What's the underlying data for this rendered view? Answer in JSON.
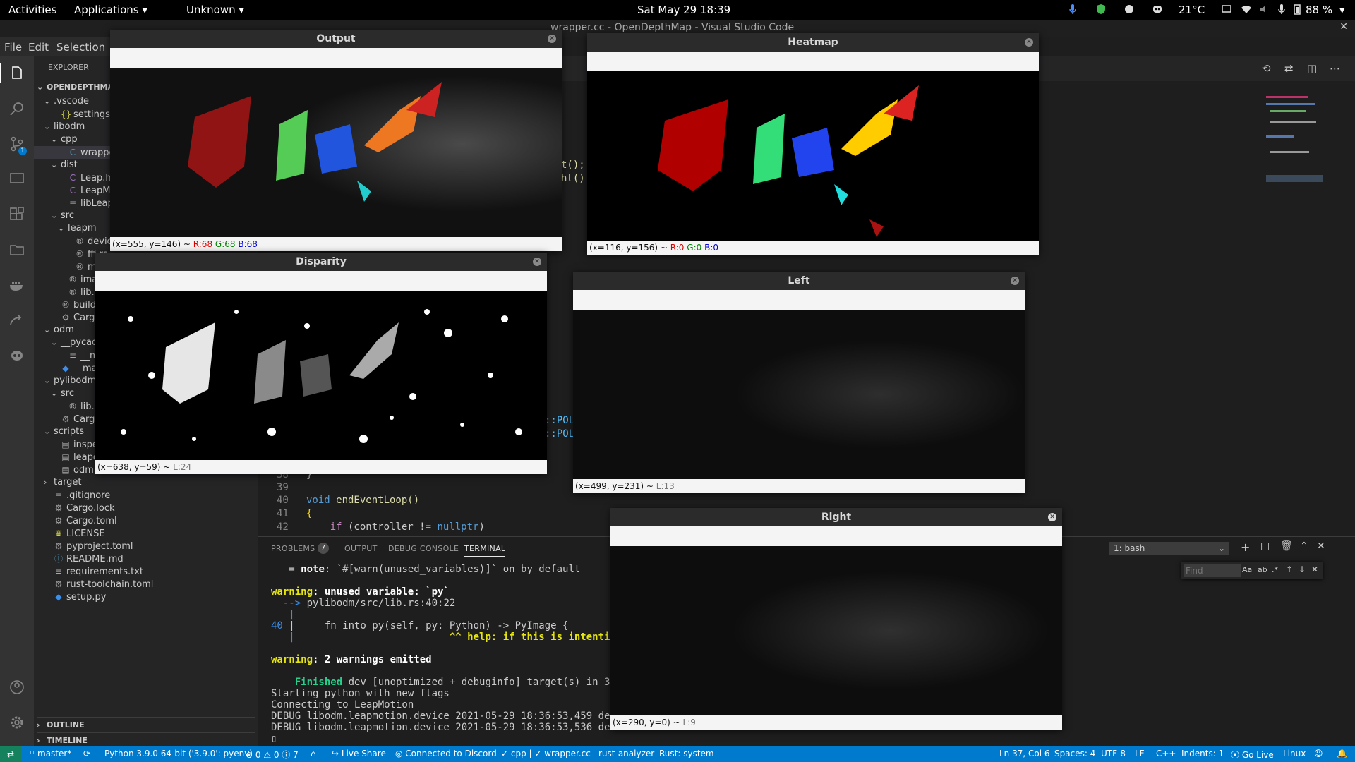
{
  "topbar": {
    "activities": "Activities",
    "applications": "Applications ▾",
    "unknown": "Unknown ▾",
    "clock": "Sat May 29  18:39",
    "temperature": "21°C",
    "battery": "88 %"
  },
  "vscode": {
    "window_title": "wrapper.cc - OpenDepthMap - Visual Studio Code",
    "menu": {
      "file": "File",
      "edit": "Edit",
      "selection": "Selection"
    },
    "explorer": {
      "header": "EXPLORER",
      "root": "OPENDEPTHMAI",
      "items": [
        {
          "label": ".vscode",
          "kind": "folder"
        },
        {
          "label": "settings.json",
          "kind": "json"
        },
        {
          "label": "libodm",
          "kind": "folder"
        },
        {
          "label": "cpp",
          "kind": "folder"
        },
        {
          "label": "wrapper.cc",
          "kind": "cpp"
        },
        {
          "label": "dist",
          "kind": "folder"
        },
        {
          "label": "Leap.h",
          "kind": "c"
        },
        {
          "label": "LeapMath",
          "kind": "c"
        },
        {
          "label": "libLeap.so",
          "kind": "file"
        },
        {
          "label": "src",
          "kind": "folder"
        },
        {
          "label": "leapm",
          "kind": "folder"
        },
        {
          "label": "devic",
          "kind": "rs"
        },
        {
          "label": "ffi.rs",
          "kind": "rs"
        },
        {
          "label": "mod.",
          "kind": "rs"
        },
        {
          "label": "image",
          "kind": "rs"
        },
        {
          "label": "lib.rs",
          "kind": "rs"
        },
        {
          "label": "build.rs",
          "kind": "rs"
        },
        {
          "label": "Cargo.t",
          "kind": "gear"
        },
        {
          "label": "odm",
          "kind": "folder"
        },
        {
          "label": "__pycac",
          "kind": "folder"
        },
        {
          "label": "__mai",
          "kind": "file"
        },
        {
          "label": "__main_",
          "kind": "py"
        },
        {
          "label": "pylibodm",
          "kind": "folder"
        },
        {
          "label": "src",
          "kind": "folder"
        },
        {
          "label": "lib.rs",
          "kind": "rs"
        },
        {
          "label": "Cargo.toml",
          "kind": "gear"
        },
        {
          "label": "scripts",
          "kind": "folder"
        },
        {
          "label": "inspect-core.sh",
          "kind": "sh"
        },
        {
          "label": "leapdebug.sh",
          "kind": "sh"
        },
        {
          "label": "odm.sh",
          "kind": "sh"
        },
        {
          "label": "target",
          "kind": "folder-closed"
        },
        {
          "label": ".gitignore",
          "kind": "file"
        },
        {
          "label": "Cargo.lock",
          "kind": "gear"
        },
        {
          "label": "Cargo.toml",
          "kind": "gear"
        },
        {
          "label": "LICENSE",
          "kind": "license"
        },
        {
          "label": "pyproject.toml",
          "kind": "gear"
        },
        {
          "label": "README.md",
          "kind": "info"
        },
        {
          "label": "requirements.txt",
          "kind": "file"
        },
        {
          "label": "rust-toolchain.toml",
          "kind": "gear"
        },
        {
          "label": "setup.py",
          "kind": "py"
        }
      ],
      "outline": "OUTLINE",
      "timeline": "TIMELINE"
    },
    "code": {
      "frag1": "t();",
      "frag2": "ht()",
      "frag3": "::POL",
      "frag4": "::POL",
      "l38": "38",
      "l39": "39",
      "l40": "40",
      "l41": "41",
      "l42": "42",
      "c38": "}",
      "c40_kw": "void",
      "c40_fn": " endEventLoop()",
      "c41": "{",
      "c42_kw": "    if",
      "c42_rest": " (controller != ",
      "c42_null": "nullptr",
      "c42_end": ")"
    },
    "panel": {
      "problems": "PROBLEMS",
      "problems_count": "7",
      "output": "OUTPUT",
      "debug_console": "DEBUG CONSOLE",
      "terminal": "TERMINAL",
      "shell": "1: bash",
      "find_placeholder": "Find",
      "lines": {
        "t1a": "   = ",
        "t1b": "note",
        "t1c": ": `#[warn(unused_variables)]` on by default",
        "t2a": "warning",
        "t2b": ": unused variable: `py`",
        "t3a": "  --> ",
        "t3b": "pylibodm/src/lib.rs:40:22",
        "t4": "   |",
        "t5a": "40",
        "t5b": " |     fn into_py(self, py: Python) -> PyImage {",
        "t6a": "   |",
        "t6b": "                          ^^ help: if this is intentional, p",
        "t7a": "warning",
        "t7b": ": 2 warnings emitted",
        "t8a": "    Finished",
        "t8b": " dev [unoptimized + debuginfo] target(s) in 3.22",
        "t9": "Starting python with new flags",
        "t10": "Connecting to LeapMotion",
        "t11": "DEBUG libodm.leapmotion.device 2021-05-29 18:36:53,459 devic",
        "t12": "DEBUG libodm.leapmotion.device 2021-05-29 18:36:53,536 devic",
        "t13": "▯"
      }
    },
    "status": {
      "remote": "⇄",
      "branch": "master*",
      "sync": "⟳",
      "python": "Python 3.9.0 64-bit ('3.9.0': pyenv)",
      "problems": "⊗ 0 ⚠ 0 ⓘ 7",
      "home": "⌂",
      "liveshare": "Live Share",
      "discord": "Connected to Discord",
      "cpp": "✓ cpp | ✓ wrapper.cc",
      "rust": "rust-analyzer",
      "rustsys": "Rust: system",
      "pos": "Ln 37, Col 6",
      "spaces": "Spaces: 4",
      "enc": "UTF-8",
      "eol": "LF",
      "lang": "C++",
      "indents": "Indents: 1",
      "golive": "Go Live",
      "os": "Linux"
    }
  },
  "windows": {
    "output": {
      "title": "Output",
      "status_pos": "(x=555, y=146) ~ ",
      "r": "R:68",
      "g": "G:68",
      "b": "B:68"
    },
    "heatmap": {
      "title": "Heatmap",
      "status_pos": "(x=116, y=156) ~ ",
      "r": "R:0",
      "g": "G:0",
      "b": "B:0"
    },
    "disparity": {
      "title": "Disparity",
      "status_pos": "(x=638, y=59) ~ ",
      "l": "L:24"
    },
    "left": {
      "title": "Left",
      "status_pos": "(x=499, y=231) ~ ",
      "l": "L:13"
    },
    "right": {
      "title": "Right",
      "status_pos": "(x=290, y=0) ~ ",
      "l": "L:9"
    }
  },
  "colors": {
    "accent": "#007acc",
    "close_glyph": "⊗"
  }
}
